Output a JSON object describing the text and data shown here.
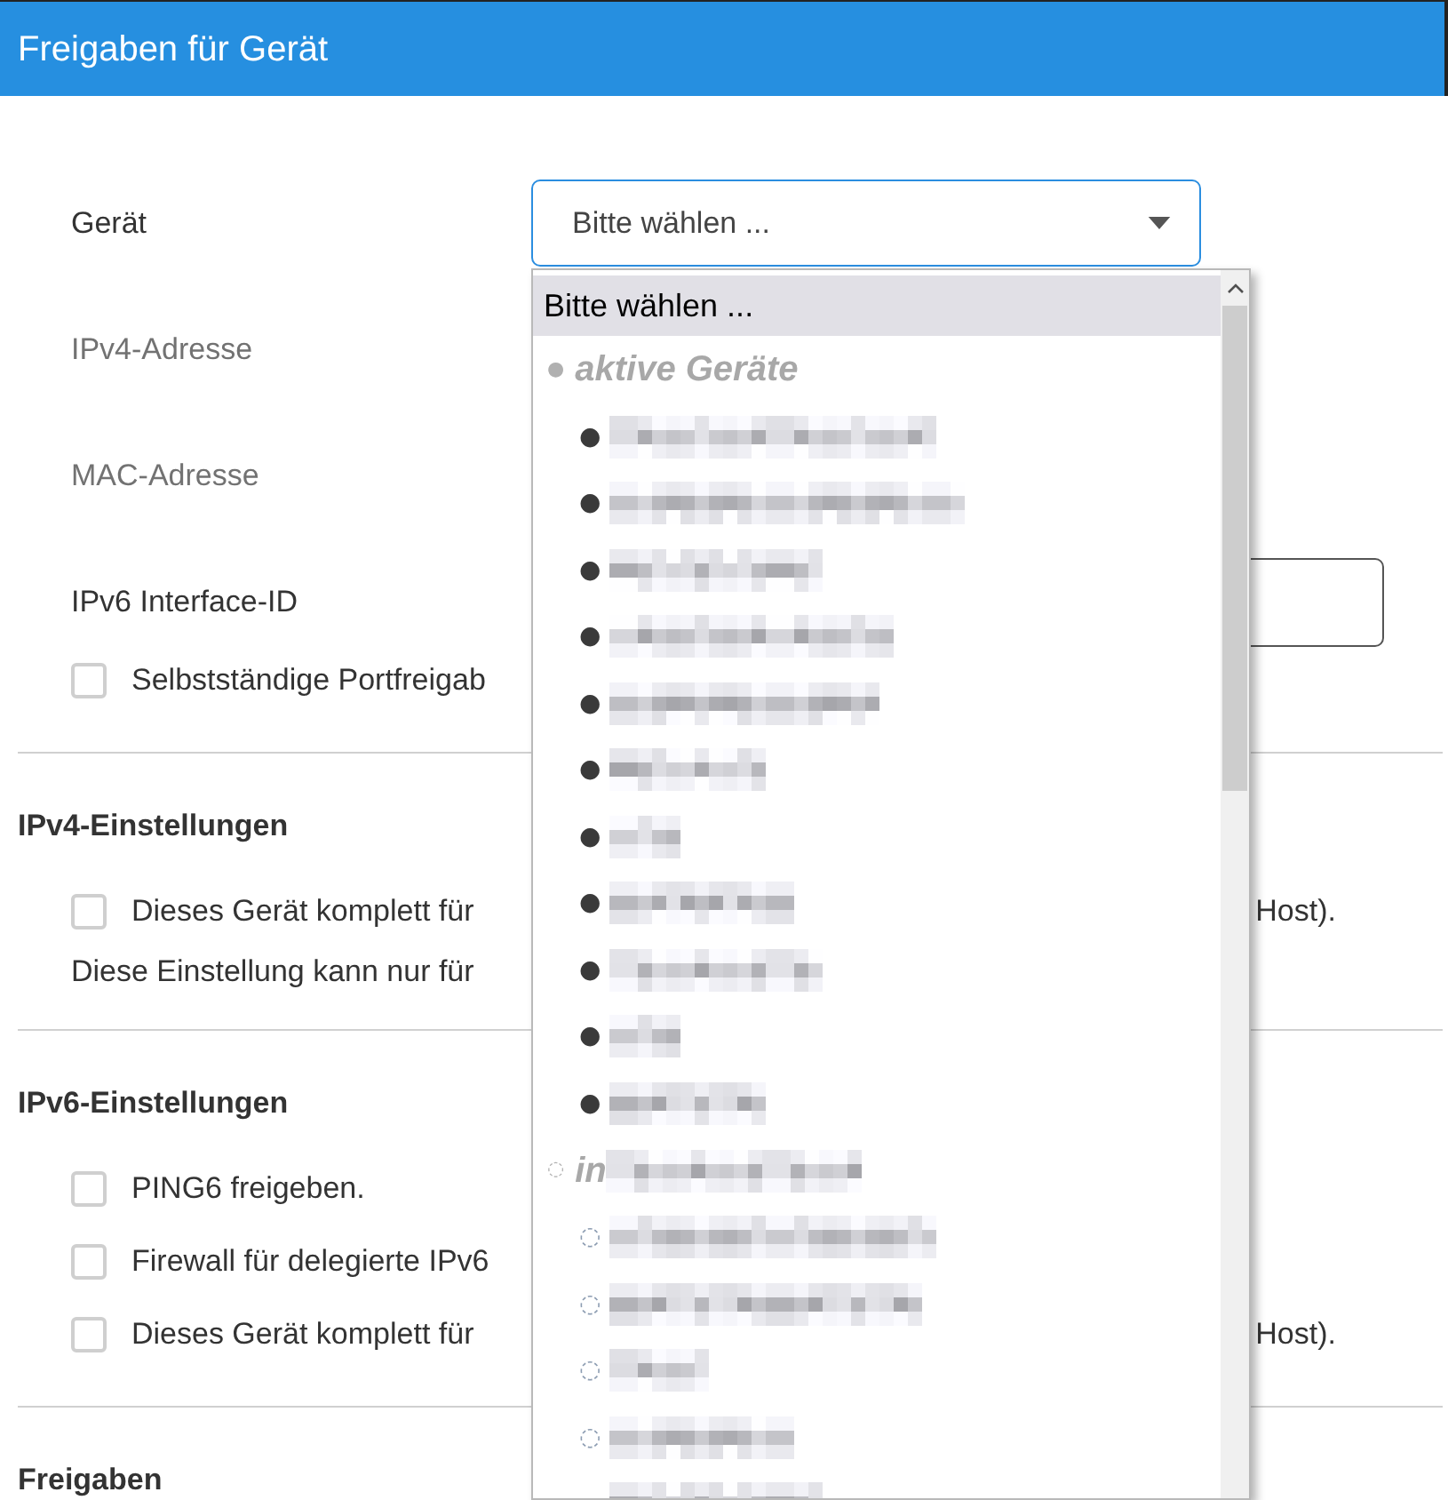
{
  "window": {
    "title": "Freigaben für Gerät"
  },
  "device_select": {
    "label": "Gerät",
    "value": "Bitte wählen ...",
    "open": true,
    "dropdown": {
      "placeholder_option": {
        "label": "Bitte wählen ...",
        "selected": true
      },
      "groups": [
        {
          "kind": "active",
          "marker": "●",
          "label": "aktive Geräte",
          "label_redacted": false,
          "children": [
            {
              "marker": "●",
              "selected": false
            },
            {
              "marker": "●",
              "selected": false
            },
            {
              "marker": "●",
              "selected": false
            },
            {
              "marker": "●",
              "selected": false
            },
            {
              "marker": "●",
              "selected": false
            },
            {
              "marker": "●",
              "selected": false
            },
            {
              "marker": "●",
              "selected": false
            },
            {
              "marker": "●",
              "selected": false
            },
            {
              "marker": "●",
              "selected": false
            },
            {
              "marker": "●",
              "selected": false
            },
            {
              "marker": "●",
              "selected": false
            }
          ]
        },
        {
          "kind": "inactive",
          "marker": "◌",
          "label": "in",
          "label_redacted": true,
          "children": [
            {
              "marker": "◌",
              "selected": false
            },
            {
              "marker": "◌",
              "selected": false
            },
            {
              "marker": "◌",
              "selected": false
            },
            {
              "marker": "◌",
              "selected": false
            },
            {
              "selected": false
            }
          ]
        }
      ]
    }
  },
  "fields": [
    {
      "kind": "text",
      "label": "IPv4-Adresse",
      "disabled": true
    },
    {
      "kind": "text",
      "label": "MAC-Adresse",
      "disabled": true
    },
    {
      "kind": "input",
      "label": "IPv6 Interface-ID",
      "disabled": false
    }
  ],
  "port_checkbox": {
    "label": "Selbstständige Portfreigab",
    "checked": false
  },
  "sections": [
    {
      "title": "IPv4-Einstellungen",
      "items": [
        {
          "kind": "checkbox",
          "label": "Dieses Gerät komplett für",
          "label_tail": "Host).",
          "checked": false
        },
        {
          "kind": "note",
          "label": "Diese Einstellung kann nur für"
        }
      ]
    },
    {
      "title": "IPv6-Einstellungen",
      "items": [
        {
          "kind": "checkbox",
          "label": "PING6 freigeben.",
          "checked": false
        },
        {
          "kind": "checkbox",
          "label": "Firewall für delegierte IPv6",
          "checked": false
        },
        {
          "kind": "checkbox",
          "label": "Dieses Gerät komplett für",
          "label_tail": "Host).",
          "checked": false
        }
      ]
    },
    {
      "title": "Freigaben"
    }
  ]
}
